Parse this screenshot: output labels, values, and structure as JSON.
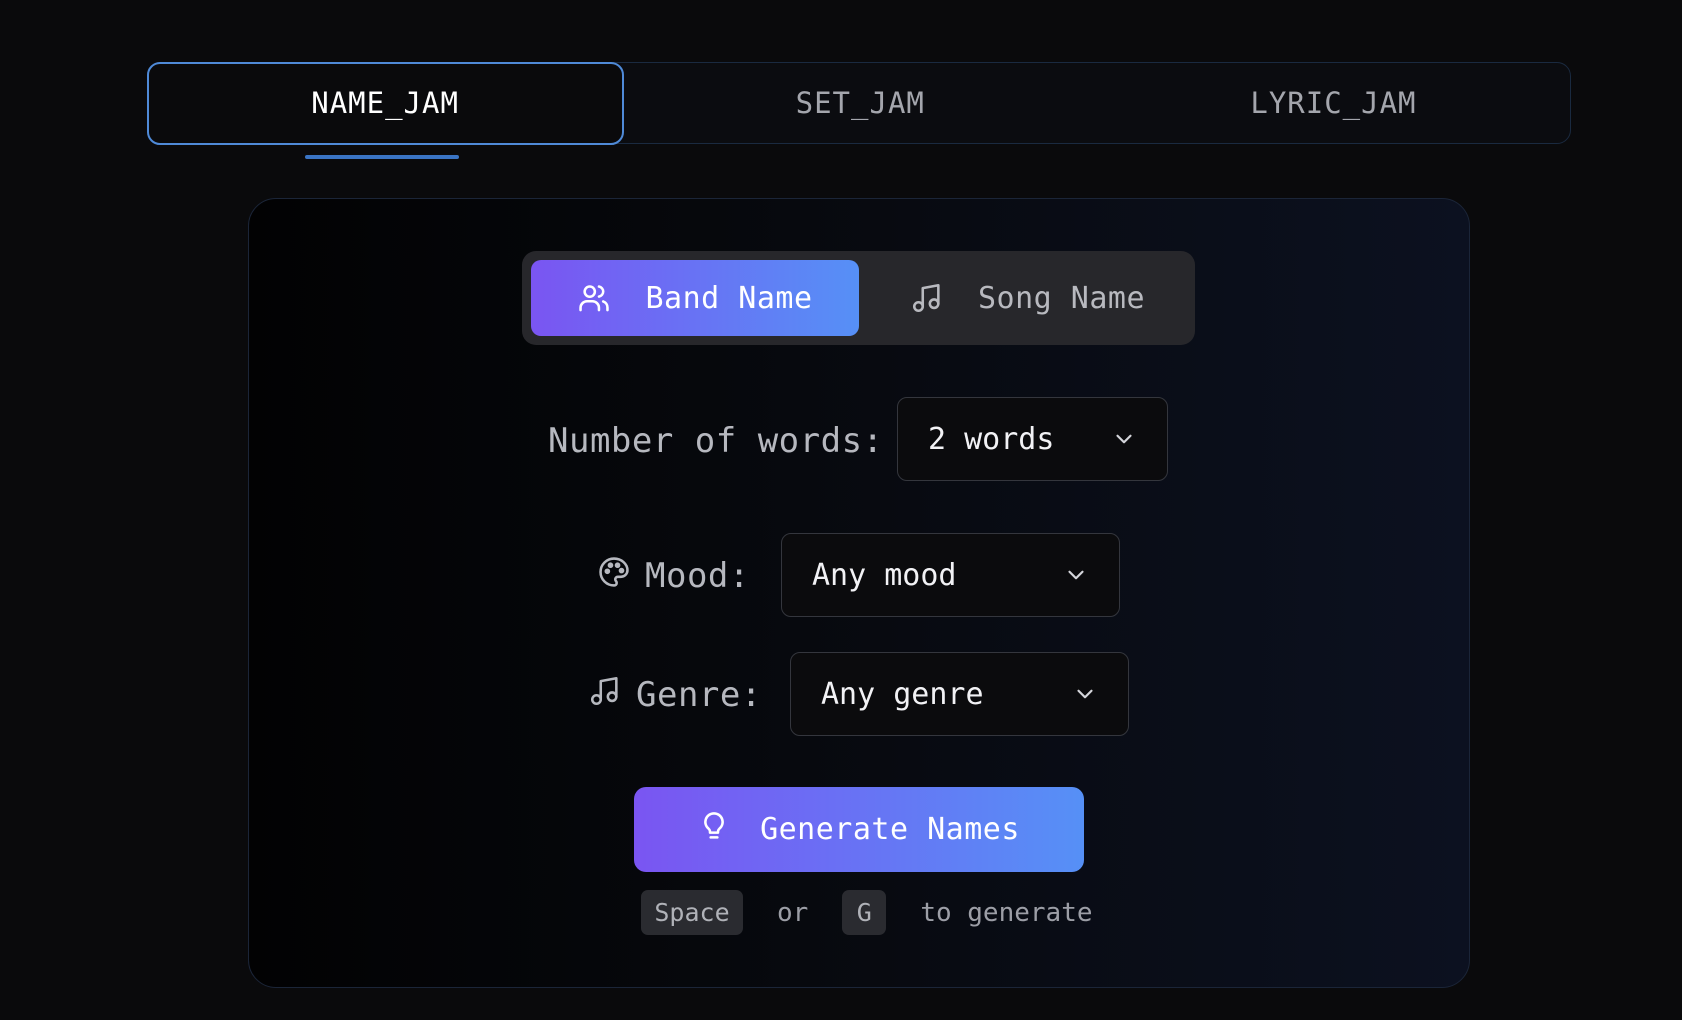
{
  "top_tabs": [
    {
      "label": "NAME_JAM",
      "active": true
    },
    {
      "label": "SET_JAM",
      "active": false
    },
    {
      "label": "LYRIC_JAM",
      "active": false
    }
  ],
  "mode_toggle": {
    "band": {
      "label": "Band Name",
      "icon": "users-icon",
      "active": true
    },
    "song": {
      "label": "Song Name",
      "icon": "music-note-icon",
      "active": false
    }
  },
  "words": {
    "label": "Number of words:",
    "value": "2 words"
  },
  "mood": {
    "label": "Mood:",
    "icon": "palette-icon",
    "value": "Any mood"
  },
  "genre": {
    "label": "Genre:",
    "icon": "music-note-icon",
    "value": "Any genre"
  },
  "generate": {
    "label": "Generate Names",
    "icon": "lightbulb-icon"
  },
  "hint": {
    "key1": "Space",
    "or": "or",
    "key2": "G",
    "suffix": "to generate"
  },
  "colors": {
    "accent_start": "#7a55f2",
    "accent_end": "#5690f6",
    "active_tab_border": "#4f8ad8"
  }
}
